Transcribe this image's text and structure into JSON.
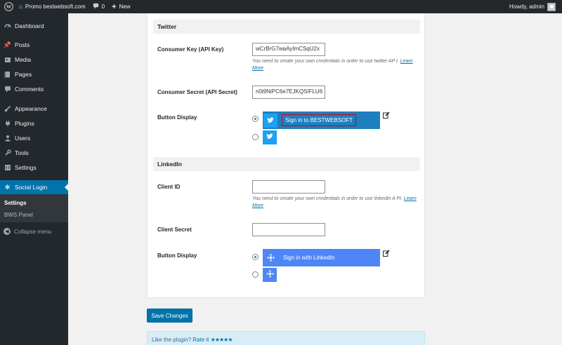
{
  "admin_bar": {
    "site_name": "Promo bestwebsoft.com",
    "comments_count": "0",
    "new_label": "New",
    "howdy": "Howdy, admin"
  },
  "sidebar": {
    "items": [
      {
        "label": "Dashboard",
        "icon": "dashboard-icon"
      },
      {
        "label": "Posts",
        "icon": "pin-icon"
      },
      {
        "label": "Media",
        "icon": "media-icon"
      },
      {
        "label": "Pages",
        "icon": "pages-icon"
      },
      {
        "label": "Comments",
        "icon": "comment-icon"
      },
      {
        "label": "Appearance",
        "icon": "brush-icon"
      },
      {
        "label": "Plugins",
        "icon": "plugin-icon"
      },
      {
        "label": "Users",
        "icon": "users-icon"
      },
      {
        "label": "Tools",
        "icon": "wrench-icon"
      },
      {
        "label": "Settings",
        "icon": "settings-icon"
      },
      {
        "label": "Social Login",
        "icon": "gear-icon"
      }
    ],
    "submenu": [
      "Settings",
      "BWS Panel"
    ],
    "collapse": "Collapse menu"
  },
  "twitter": {
    "heading": "Twitter",
    "consumer_key_label": "Consumer Key (API Key)",
    "consumer_key_value": "wCrBrG7waAyImCSqU2x",
    "help_text": "You need to create your own credentials in order to use twitter AP I.",
    "learn_more": "Learn More",
    "consumer_secret_label": "Consumer Secret (API Secret)",
    "consumer_secret_value": "n0i9NiPC6e7EJKQSIFLU6",
    "button_display_label": "Button Display",
    "sign_in_label": "Sign in to BESTWEBSOFT"
  },
  "linkedin": {
    "heading": "LinkedIn",
    "client_id_label": "Client ID",
    "client_id_value": "",
    "help_text": "You need to create your own credentials in order to use linkedin A PI.",
    "learn_more": "Learn More",
    "client_secret_label": "Client Secret",
    "client_secret_value": "",
    "button_display_label": "Button Display",
    "sign_in_label": "Sign in with LinkedIn"
  },
  "save_label": "Save Changes",
  "rate": {
    "text": "Like the plugin?",
    "link": "Rate it",
    "stars": "★★★★★"
  },
  "colors": {
    "accent": "#0073aa",
    "twitter": "#1da1f2",
    "linkedin": "#4f86f7",
    "admin_dark": "#23282d"
  }
}
